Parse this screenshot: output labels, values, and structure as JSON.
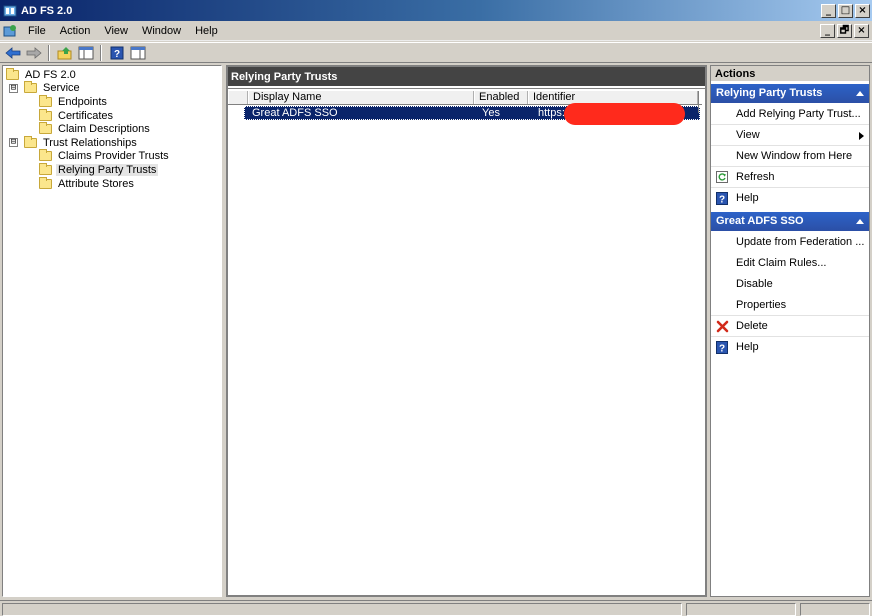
{
  "window": {
    "title": "AD FS 2.0",
    "caption_buttons": [
      "_",
      "□",
      "×"
    ]
  },
  "menu": {
    "items": [
      "File",
      "Action",
      "View",
      "Window",
      "Help"
    ],
    "mdi_buttons": [
      "_",
      "🗗",
      "×"
    ]
  },
  "toolbar": {
    "buttons": [
      "back-arrow-icon",
      "forward-arrow-icon",
      "up-folder-icon",
      "show-hide-tree-icon",
      "help-icon",
      "show-hide-action-pane-icon"
    ]
  },
  "tree": {
    "root": "AD FS 2.0",
    "service": {
      "label": "Service",
      "expander": "⊟",
      "children": [
        "Endpoints",
        "Certificates",
        "Claim Descriptions"
      ]
    },
    "trust": {
      "label": "Trust Relationships",
      "expander": "⊟",
      "children": [
        "Claims Provider Trusts",
        "Relying Party Trusts",
        "Attribute Stores"
      ]
    }
  },
  "center": {
    "title": "Relying Party Trusts",
    "columns": [
      "Display Name",
      "Enabled",
      "Identifier"
    ],
    "rows": [
      {
        "display_name": "Great ADFS SSO",
        "enabled": "Yes",
        "identifier": "https:/"
      }
    ]
  },
  "actions": {
    "title": "Actions",
    "section1": {
      "header": "Relying Party Trusts",
      "items": [
        "Add Relying Party Trust...",
        "View",
        "New Window from Here",
        "Refresh",
        "Help"
      ]
    },
    "section2": {
      "header": "Great ADFS SSO",
      "items": [
        "Update from Federation ...",
        "Edit Claim Rules...",
        "Disable",
        "Properties",
        "Delete",
        "Help"
      ]
    }
  },
  "colors": {
    "selection": "#0a246a",
    "section_header": "#2d63c8",
    "redaction": "#ff2a1c",
    "pane_header": "#444444"
  }
}
